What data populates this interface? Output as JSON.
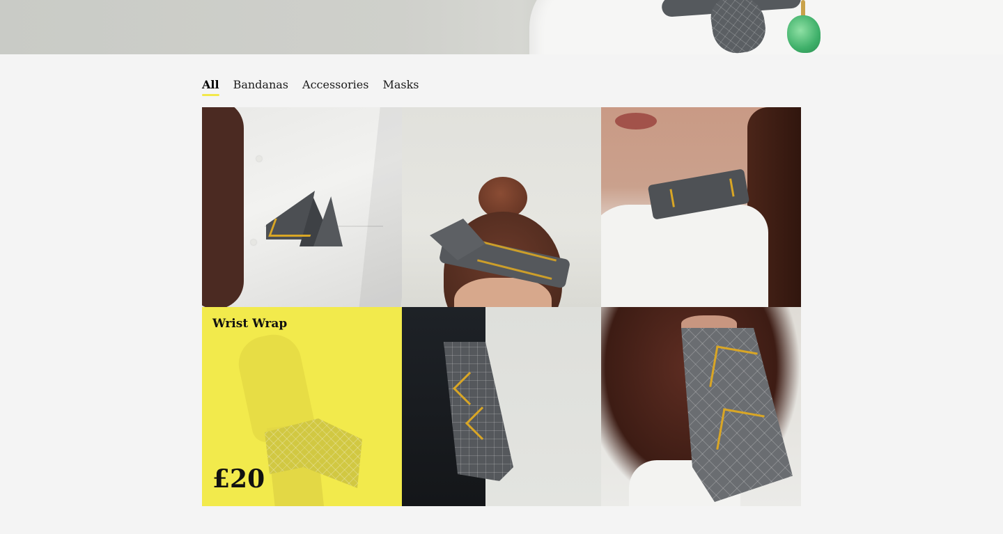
{
  "nav": {
    "tabs": [
      {
        "label": "All",
        "active": true
      },
      {
        "label": "Bandanas",
        "active": false
      },
      {
        "label": "Accessories",
        "active": false
      },
      {
        "label": "Masks",
        "active": false
      }
    ]
  },
  "products": {
    "highlight": {
      "title": "Wrist Wrap",
      "price": "£20"
    }
  },
  "colors": {
    "accent": "#f2ea4c",
    "background": "#f4f4f4",
    "pattern_gold": "#d9a625",
    "fabric_gray": "#55585c"
  }
}
